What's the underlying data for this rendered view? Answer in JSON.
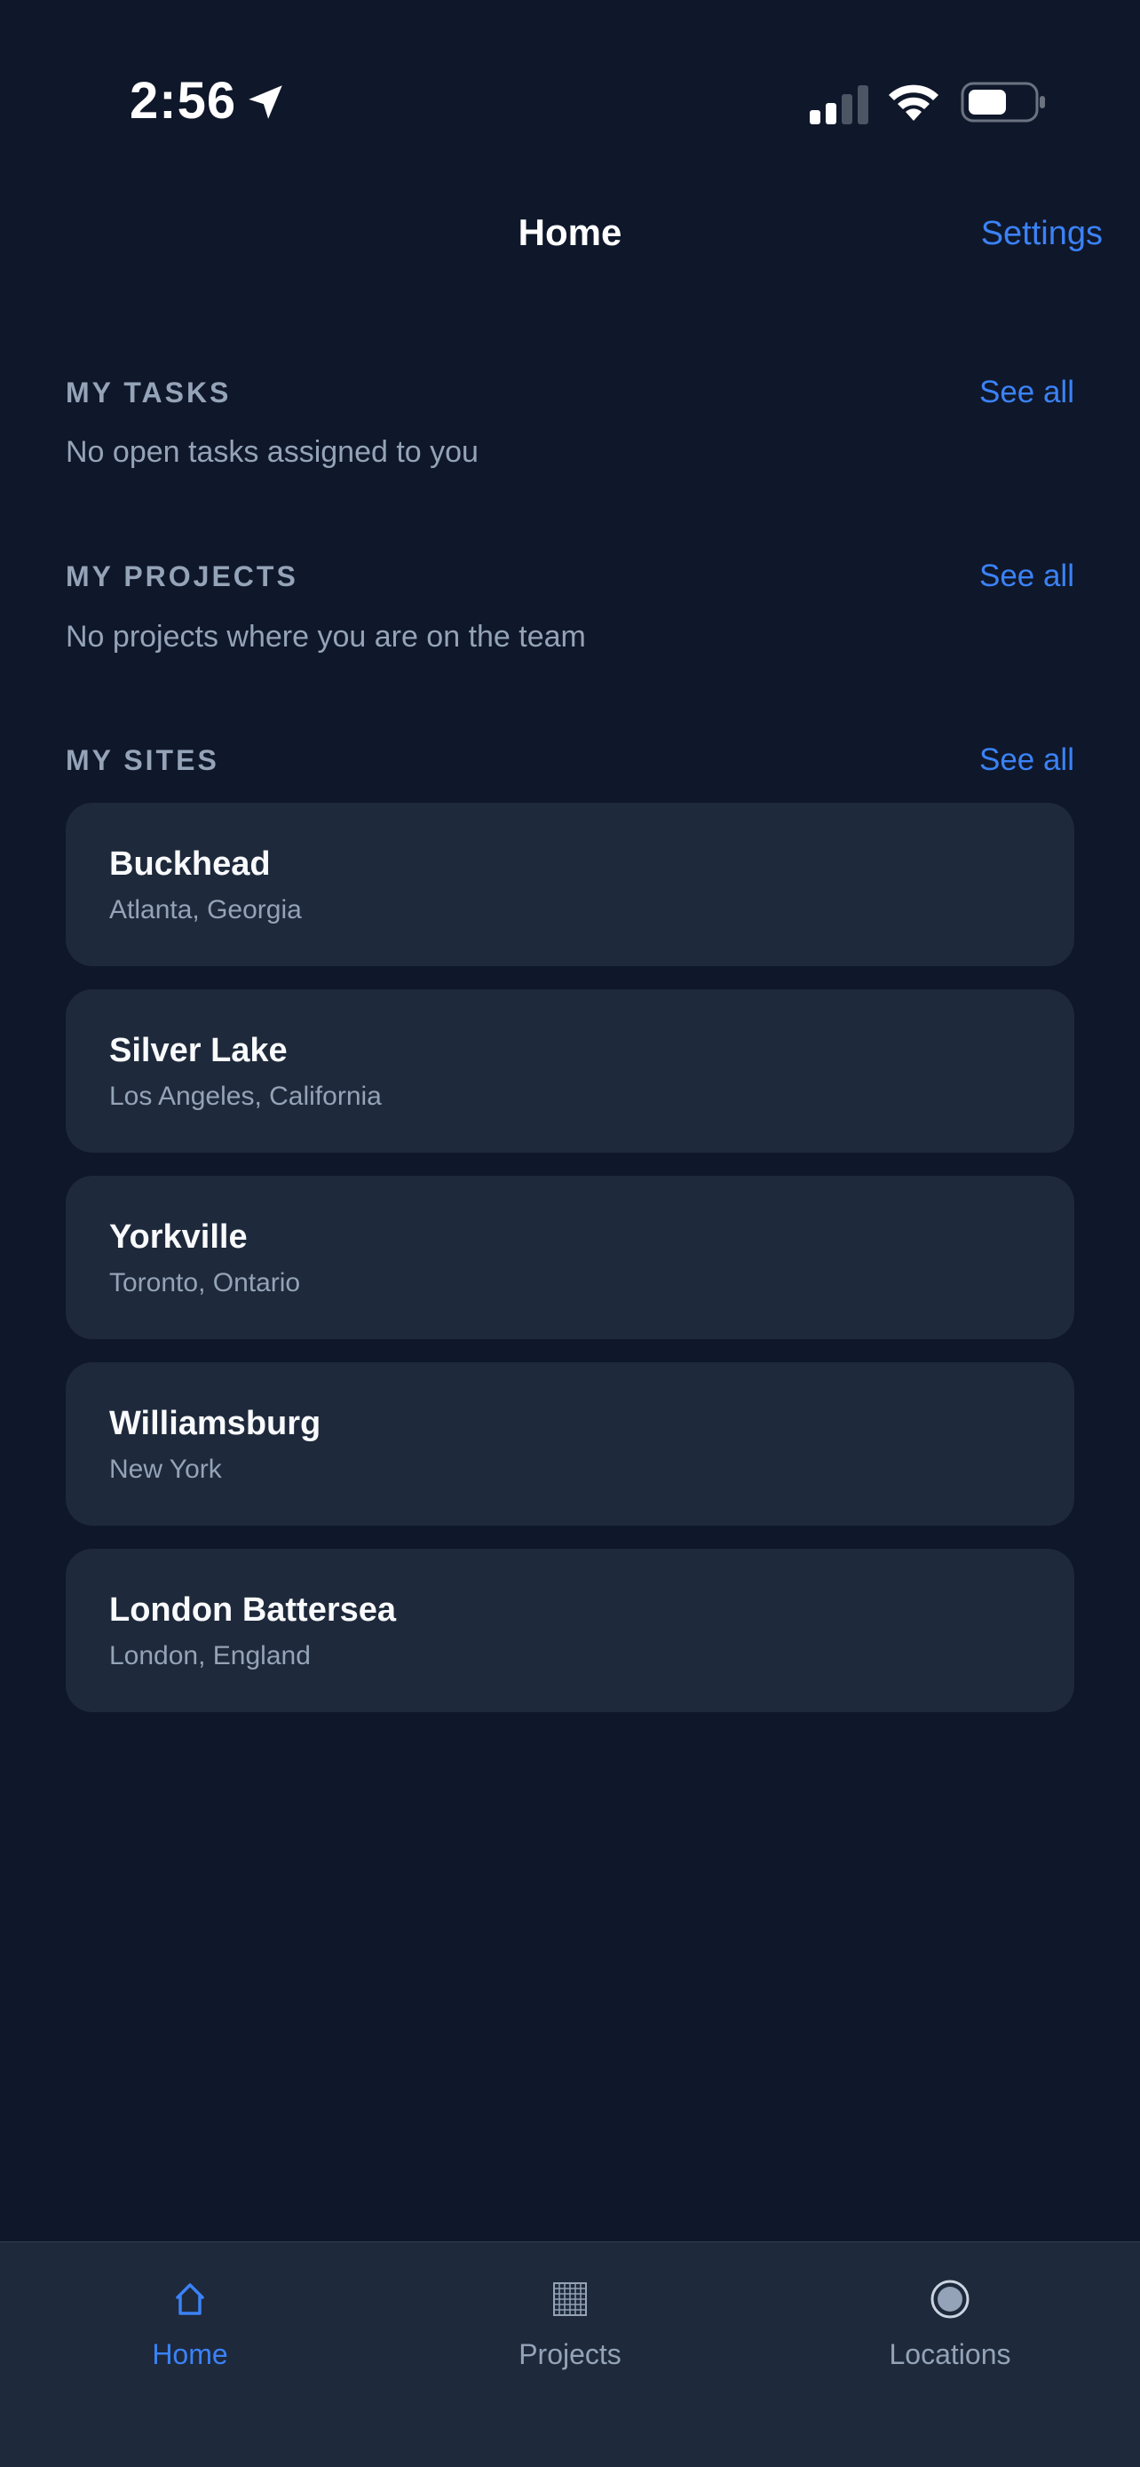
{
  "status_bar": {
    "time": "2:56",
    "icons": [
      "location-arrow-icon",
      "signal-icon",
      "wifi-icon",
      "battery-icon"
    ]
  },
  "nav": {
    "title": "Home",
    "settings_label": "Settings"
  },
  "sections": {
    "tasks": {
      "title": "MY TASKS",
      "see_all": "See all",
      "empty": "No open tasks assigned to you"
    },
    "projects": {
      "title": "MY PROJECTS",
      "see_all": "See all",
      "empty": "No projects where you are on the team"
    },
    "sites": {
      "title": "MY SITES",
      "see_all": "See all",
      "items": [
        {
          "name": "Buckhead",
          "location": "Atlanta, Georgia"
        },
        {
          "name": "Silver Lake",
          "location": "Los Angeles, California"
        },
        {
          "name": "Yorkville",
          "location": "Toronto, Ontario"
        },
        {
          "name": "Williamsburg",
          "location": "New York"
        },
        {
          "name": "London Battersea",
          "location": "London, England"
        }
      ]
    }
  },
  "tab_bar": {
    "tabs": [
      {
        "label": "Home",
        "icon": "home-icon",
        "active": true
      },
      {
        "label": "Projects",
        "icon": "grid-icon",
        "active": false
      },
      {
        "label": "Locations",
        "icon": "location-pin-icon",
        "active": false
      }
    ]
  },
  "colors": {
    "background": "#0f172a",
    "card": "#1e293b",
    "accent": "#3b82f6",
    "muted_text": "#94a3b8",
    "primary_text": "#f8fafc"
  }
}
